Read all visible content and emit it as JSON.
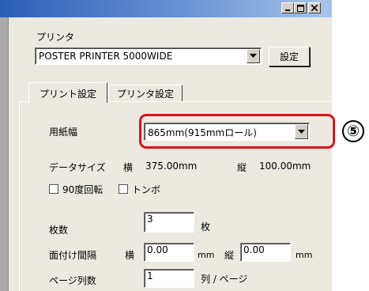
{
  "printer": {
    "label": "プリンタ",
    "selected": "POSTER PRINTER 5000WIDE",
    "settings_button": "設定"
  },
  "tabs": [
    {
      "label": "プリント設定",
      "active": true
    },
    {
      "label": "プリンタ設定",
      "active": false
    }
  ],
  "paper_width": {
    "label": "用紙幅",
    "selected": "865mm(915mmロール)"
  },
  "data_size": {
    "label": "データサイズ",
    "width_label": "横",
    "width_value": "375.00mm",
    "height_label": "縦",
    "height_value": "100.00mm"
  },
  "options": {
    "rotate90_label": "90度回転",
    "rotate90_checked": false,
    "crop_marks_label": "トンボ",
    "crop_marks_checked": false
  },
  "copies": {
    "label": "枚数",
    "value": "3",
    "unit": "枚"
  },
  "imposition_gap": {
    "label": "面付け間隔",
    "h_label": "横",
    "h_value": "0.00",
    "h_unit": "mm",
    "v_label": "縦",
    "v_value": "0.00",
    "v_unit": "mm"
  },
  "columns_per_page": {
    "label": "ページ列数",
    "value": "1",
    "unit": "列 / ページ"
  },
  "annotation": {
    "marker": "⑤"
  },
  "colors": {
    "highlight": "#e0101a",
    "dialog_bg": "#ece9e1"
  },
  "icons": [
    "minimize-icon",
    "maximize-icon",
    "close-icon",
    "dropdown-arrow-icon",
    "checkbox-icon"
  ]
}
